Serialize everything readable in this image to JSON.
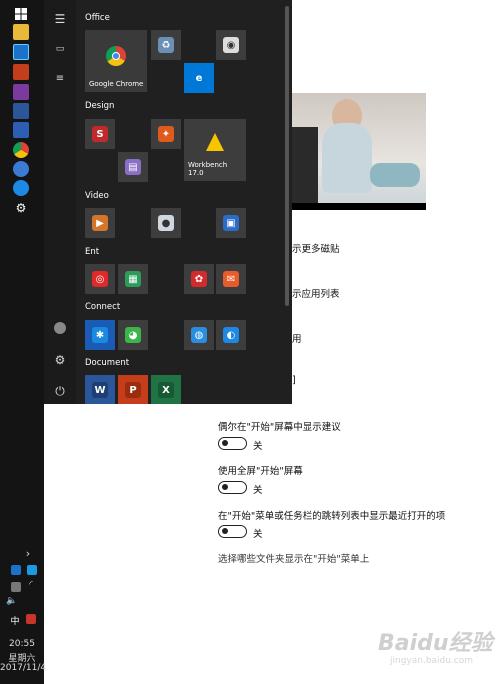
{
  "start_menu": {
    "groups": {
      "office": "Office",
      "design": "Design",
      "video": "Video",
      "ent": "Ent",
      "connect": "Connect",
      "document": "Document"
    },
    "tiles": {
      "chrome": "Google Chrome",
      "workbench": "Workbench\n17.0"
    }
  },
  "settings": {
    "partial_lines": [
      "示更多磁贴",
      "示应用列表",
      "用",
      "]"
    ],
    "options": [
      {
        "label": "偶尔在\"开始\"屏幕中显示建议",
        "state": "关"
      },
      {
        "label": "使用全屏\"开始\"屏幕",
        "state": "关"
      },
      {
        "label": "在\"开始\"菜单或任务栏的跳转列表中显示最近打开的项",
        "state": "关"
      }
    ],
    "folders_link": "选择哪些文件夹显示在\"开始\"菜单上"
  },
  "taskbar": {
    "ime": "中",
    "time": "20:55",
    "weekday": "星期六",
    "date": "2017/11/4"
  },
  "watermark": {
    "logo": "Baidu经验",
    "url": "jingyan.baidu.com"
  },
  "colors": {
    "taskbar_bg": "#141414",
    "panel_bg": "#202020",
    "tile_bg": "#3d3d3d",
    "accent_blue": "#0078d7"
  }
}
